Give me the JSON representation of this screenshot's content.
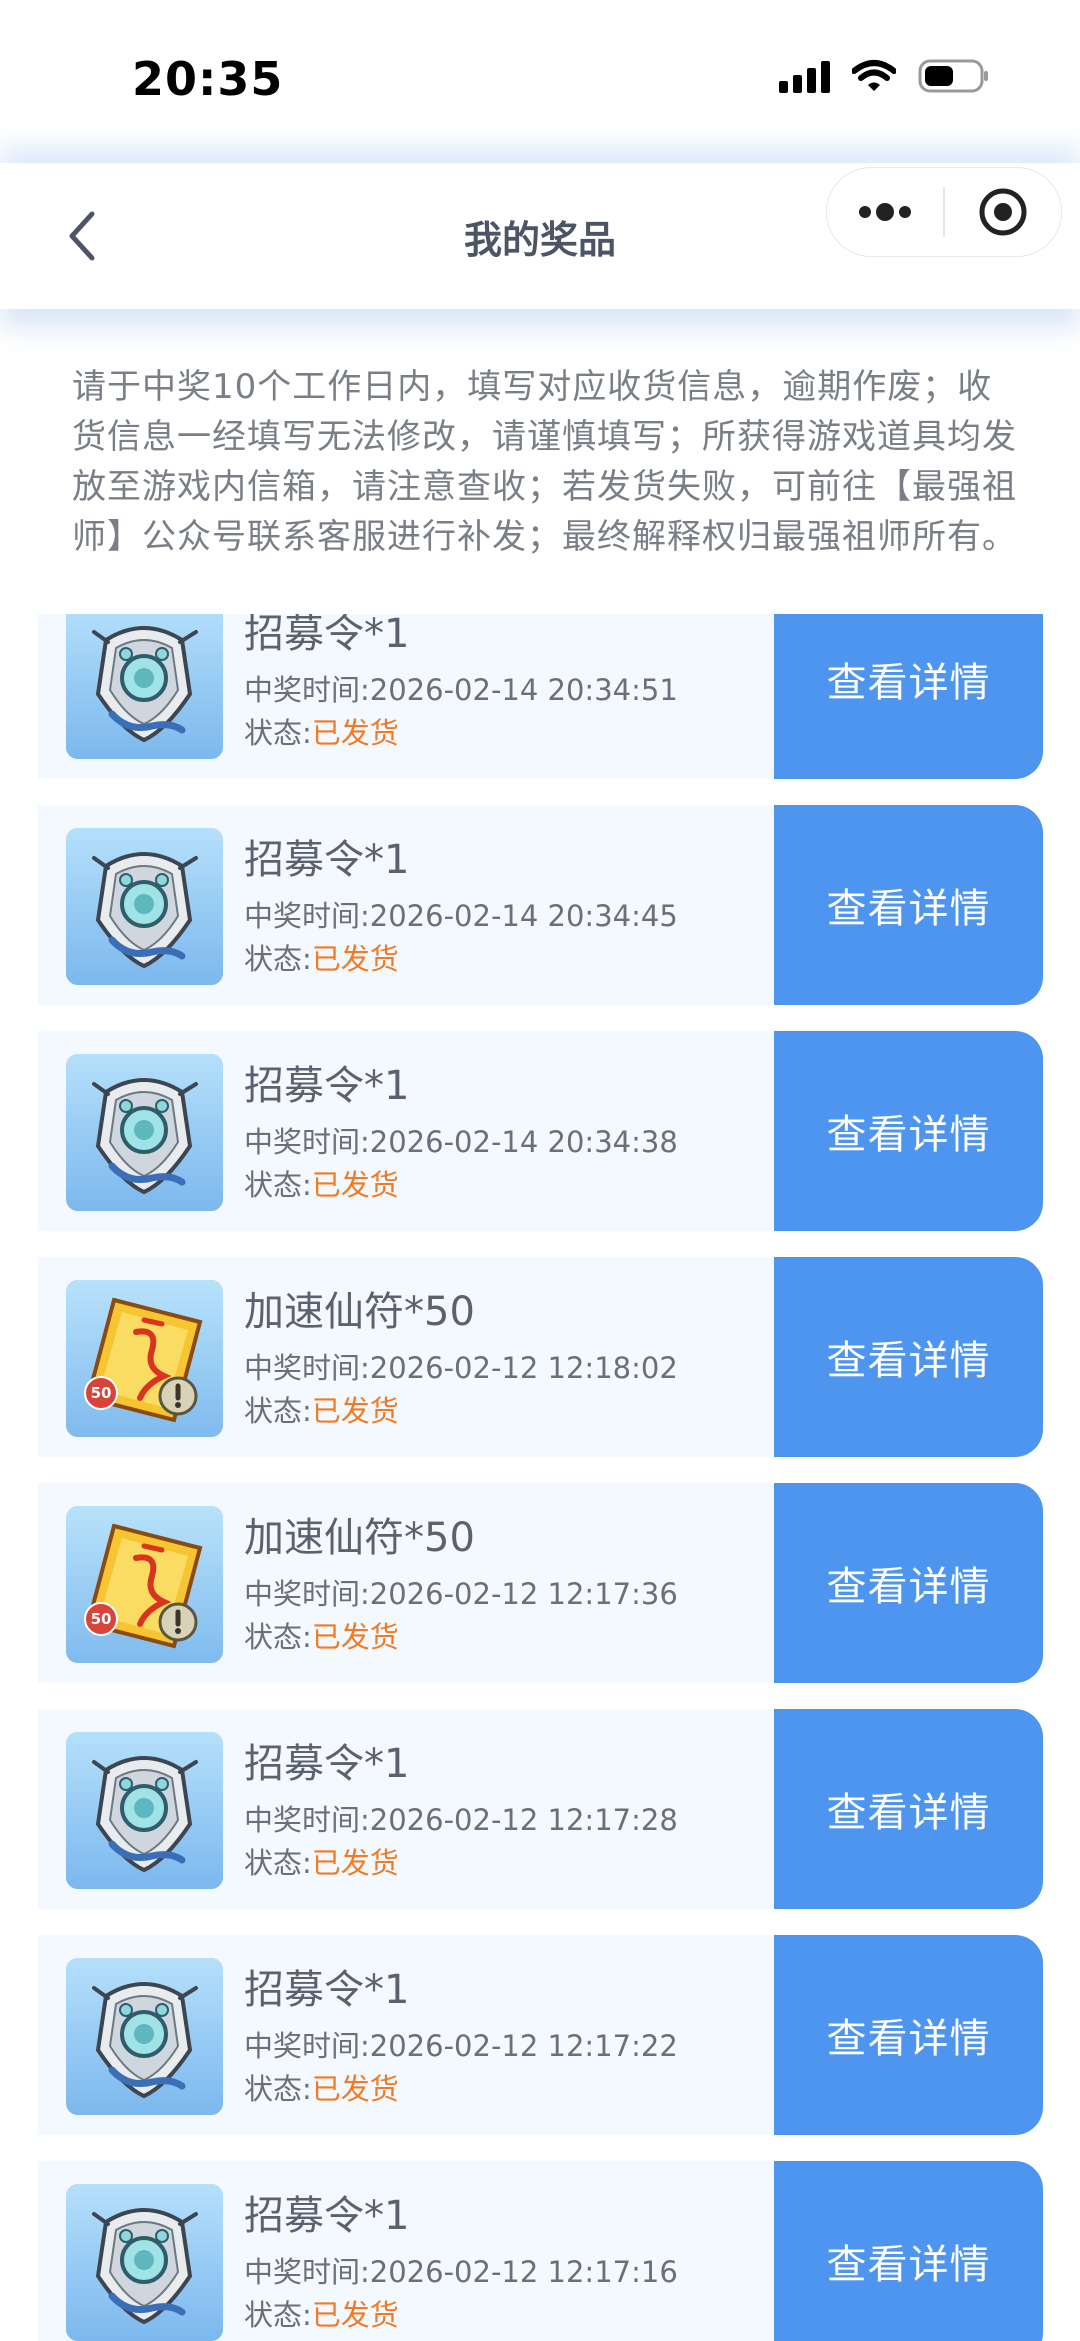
{
  "status_bar": {
    "time": "20:35"
  },
  "nav": {
    "title": "我的奖品"
  },
  "notice": "请于中奖10个工作日内，填写对应收货信息，逾期作废；收货信息一经填写无法修改，请谨慎填写；所获得游戏道具均发放至游戏内信箱，请注意查收；若发货失败，可前往【最强祖师】公众号联系客服进行补发；最终解释权归最强祖师所有。",
  "time_label": "中奖时间:",
  "status_label": "状态:",
  "detail_label": "查看详情",
  "colors": {
    "button": "#4e95ef",
    "status_shipped": "#f07b24",
    "card_background": "#f3f9fe"
  },
  "prizes": [
    {
      "name": "招募令*1",
      "time": "2026-02-14 20:34:51",
      "status": "已发货",
      "icon": "recruit-token-icon"
    },
    {
      "name": "招募令*1",
      "time": "2026-02-14 20:34:45",
      "status": "已发货",
      "icon": "recruit-token-icon"
    },
    {
      "name": "招募令*1",
      "time": "2026-02-14 20:34:38",
      "status": "已发货",
      "icon": "recruit-token-icon"
    },
    {
      "name": "加速仙符*50",
      "time": "2026-02-12 12:18:02",
      "status": "已发货",
      "icon": "speedup-talisman-icon",
      "badge": "50"
    },
    {
      "name": "加速仙符*50",
      "time": "2026-02-12 12:17:36",
      "status": "已发货",
      "icon": "speedup-talisman-icon",
      "badge": "50"
    },
    {
      "name": "招募令*1",
      "time": "2026-02-12 12:17:28",
      "status": "已发货",
      "icon": "recruit-token-icon"
    },
    {
      "name": "招募令*1",
      "time": "2026-02-12 12:17:22",
      "status": "已发货",
      "icon": "recruit-token-icon"
    },
    {
      "name": "招募令*1",
      "time": "2026-02-12 12:17:16",
      "status": "已发货",
      "icon": "recruit-token-icon"
    }
  ]
}
